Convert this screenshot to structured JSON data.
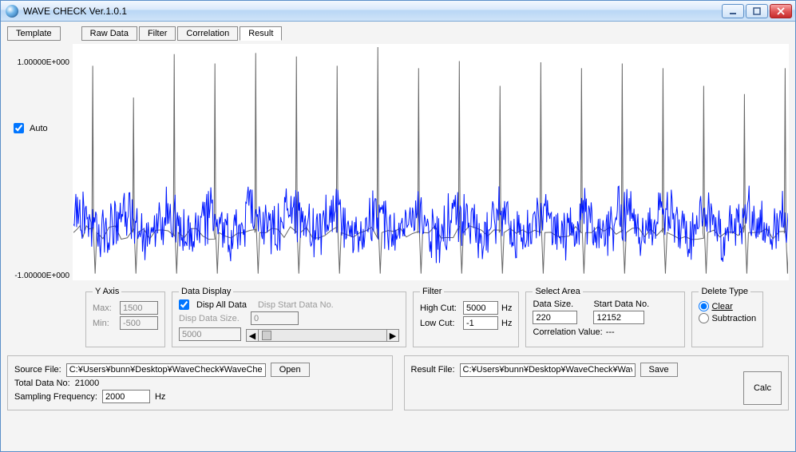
{
  "window": {
    "title": "WAVE CHECK Ver.1.0.1"
  },
  "toolbar": {
    "template_label": "Template"
  },
  "tabs": [
    "Raw Data",
    "Filter",
    "Correlation",
    "Result"
  ],
  "tabs_active_index": 3,
  "axis": {
    "top_label": "1.00000E+000",
    "bot_label": "-1.00000E+000"
  },
  "auto": {
    "label": "Auto",
    "checked": true
  },
  "yaxis_panel": {
    "legend": "Y Axis",
    "max_label": "Max:",
    "max_value": "1500",
    "min_label": "Min:",
    "min_value": "-500"
  },
  "data_display": {
    "legend": "Data Display",
    "disp_all_label": "Disp All Data",
    "disp_all_checked": true,
    "disp_start_label": "Disp Start Data No.",
    "disp_start_value": "0",
    "disp_size_label": "Disp Data Size.",
    "disp_size_value": "5000"
  },
  "filter_panel": {
    "legend": "Filter",
    "high_label": "High Cut:",
    "high_value": "5000",
    "high_unit": "Hz",
    "low_label": "Low Cut:",
    "low_value": "-1",
    "low_unit": "Hz"
  },
  "select_area": {
    "legend": "Select Area",
    "size_label": "Data Size.",
    "size_value": "220",
    "start_label": "Start Data No.",
    "start_value": "12152",
    "corr_label": "Correlation Value:",
    "corr_value": "---"
  },
  "delete_type": {
    "legend": "Delete Type",
    "clear_label": "Clear",
    "subtraction_label": "Subtraction",
    "selected": "clear"
  },
  "source": {
    "label": "Source File:",
    "value": "C:¥Users¥bunn¥Desktop¥WaveCheck¥WaveCheck",
    "open_label": "Open",
    "total_label": "Total Data No:",
    "total_value": "21000",
    "freq_label": "Sampling Frequency:",
    "freq_value": "2000",
    "freq_unit": "Hz"
  },
  "result": {
    "label": "Result File:",
    "value": "C:¥Users¥bunn¥Desktop¥WaveCheck¥WaveC",
    "save_label": "Save"
  },
  "calc_label": "Calc",
  "chart_data": {
    "type": "line",
    "ylim": [
      -1.0,
      1.0
    ],
    "xlabel": "",
    "ylabel": "",
    "title": "",
    "series": [
      {
        "name": "gray-spikes",
        "color": "#666666",
        "baseline": -0.6,
        "spike_height_to": 0.98,
        "spike_x_positions_fraction": [
          0.027,
          0.084,
          0.141,
          0.198,
          0.255,
          0.312,
          0.369,
          0.426,
          0.483,
          0.54,
          0.597,
          0.654,
          0.711,
          0.768,
          0.825,
          0.882,
          0.939,
          0.996
        ],
        "spike_top_values_approx": [
          0.82,
          0.55,
          0.92,
          0.84,
          0.93,
          0.9,
          0.82,
          0.98,
          0.8,
          0.86,
          0.65,
          0.85,
          0.8,
          0.84,
          0.8,
          0.65,
          0.58,
          0.8
        ]
      },
      {
        "name": "blue-noise",
        "color": "#0018ff",
        "mean": -0.53,
        "amplitude": 0.22,
        "note": "dense noisy trace approximated; exact per-sample values not readable"
      }
    ]
  }
}
